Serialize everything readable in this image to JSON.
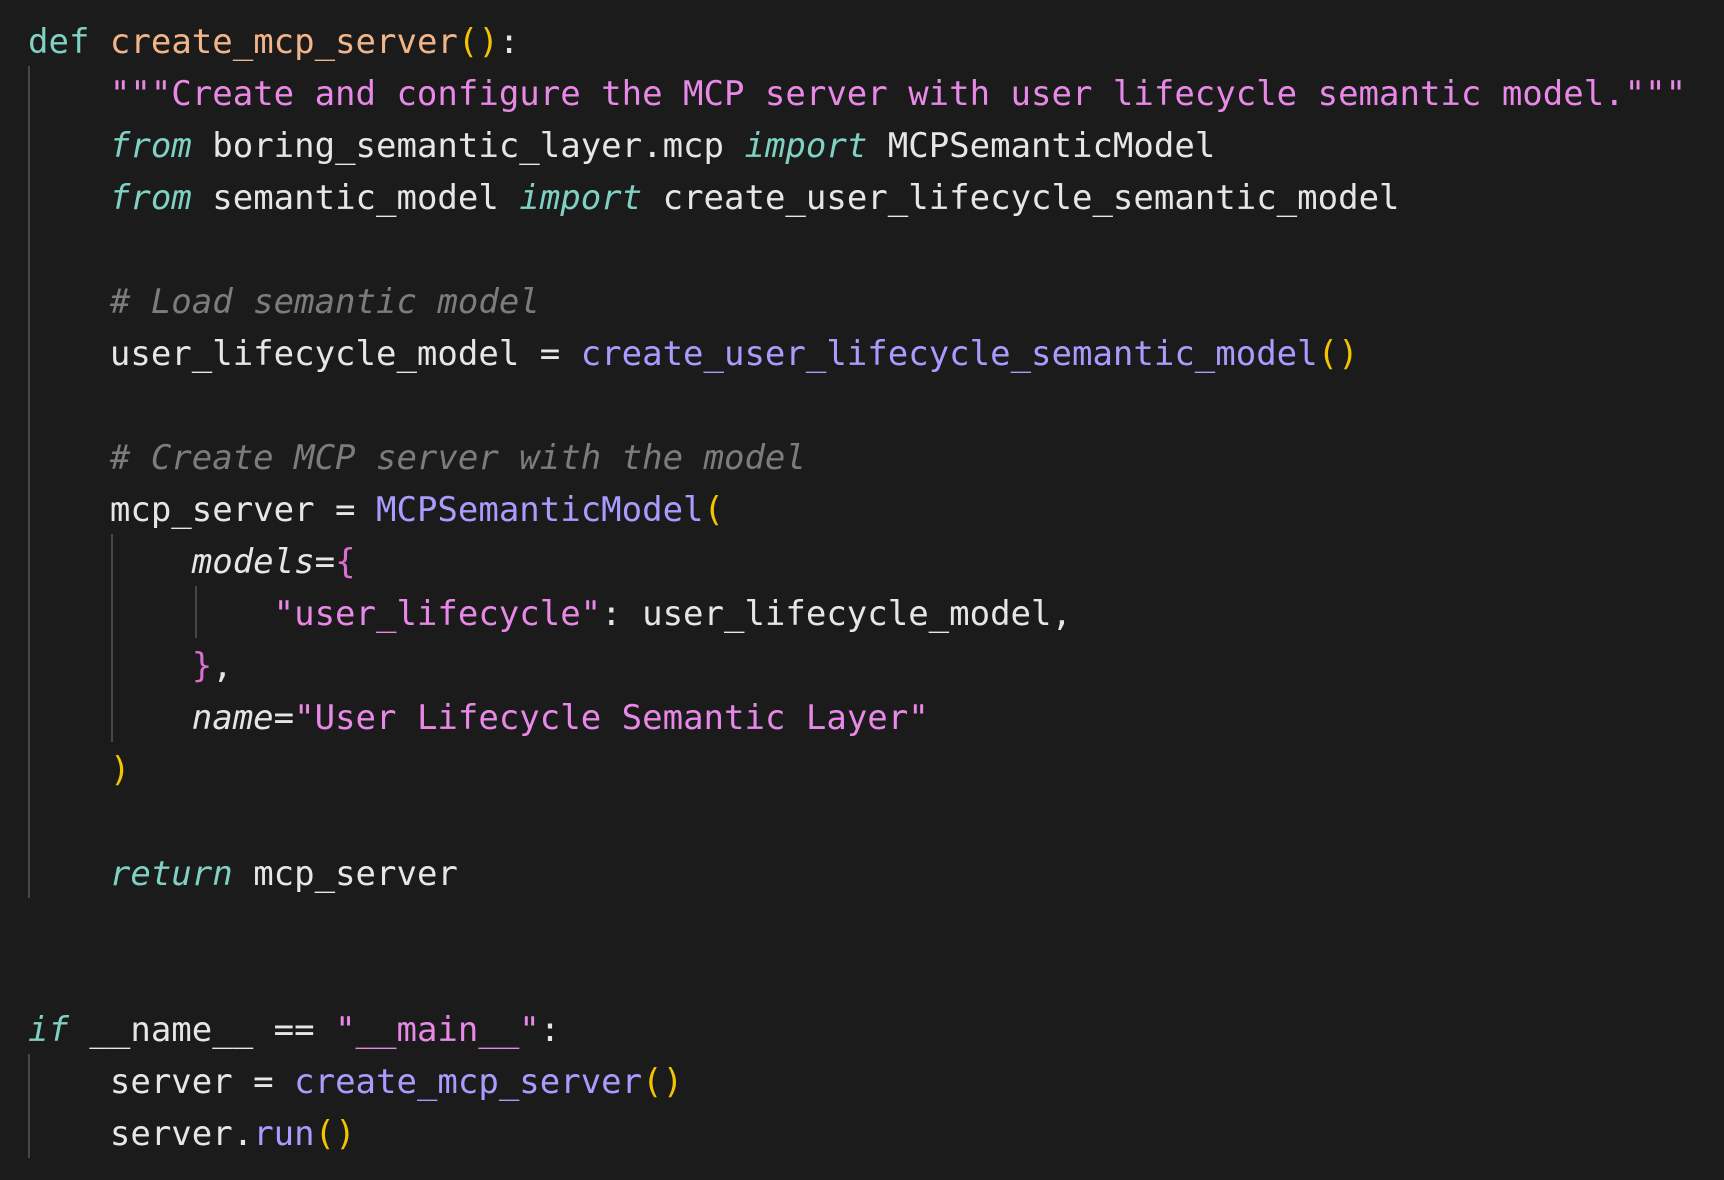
{
  "code": {
    "l1": {
      "kw": "def",
      "sp": " ",
      "fn": "create_mcp_server",
      "p": "()",
      "c": ":"
    },
    "l2": {
      "indent": "    ",
      "doc": "\"\"\"Create and configure the MCP server with user lifecycle semantic model.\"\"\""
    },
    "l3": {
      "indent": "    ",
      "kw_from": "from",
      "mod": " boring_semantic_layer.mcp ",
      "kw_import": "import",
      "name": " MCPSemanticModel"
    },
    "l4": {
      "indent": "    ",
      "kw_from": "from",
      "mod": " semantic_model ",
      "kw_import": "import",
      "name": " create_user_lifecycle_semantic_model"
    },
    "l6": {
      "indent": "    ",
      "comment": "# Load semantic model"
    },
    "l7": {
      "indent": "    ",
      "lhs": "user_lifecycle_model = ",
      "call": "create_user_lifecycle_semantic_model",
      "p": "()"
    },
    "l9": {
      "indent": "    ",
      "comment": "# Create MCP server with the model"
    },
    "l10": {
      "indent": "    ",
      "lhs": "mcp_server = ",
      "cls": "MCPSemanticModel",
      "p": "("
    },
    "l11": {
      "indent": "        ",
      "kwarg": "models",
      "eq": "=",
      "brace": "{"
    },
    "l12": {
      "indent": "            ",
      "key": "\"user_lifecycle\"",
      "rest": ": user_lifecycle_model,"
    },
    "l13": {
      "indent": "        ",
      "brace": "}",
      "rest": ","
    },
    "l14": {
      "indent": "        ",
      "kwarg": "name",
      "eq": "=",
      "str": "\"User Lifecycle Semantic Layer\""
    },
    "l15": {
      "indent": "    ",
      "p": ")"
    },
    "l17": {
      "indent": "    ",
      "kw": "return",
      "rest": " mcp_server"
    },
    "l20": {
      "kw": "if",
      "rest1": " __name__ == ",
      "str": "\"__main__\"",
      "rest2": ":"
    },
    "l21": {
      "indent": "    ",
      "lhs": "server = ",
      "call": "create_mcp_server",
      "p": "()"
    },
    "l22": {
      "indent": "    ",
      "obj": "server.",
      "call": "run",
      "p": "()"
    }
  },
  "colors": {
    "background": "#1b1b1b",
    "keyword": "#7fd1c3",
    "function_name": "#f2b58a",
    "paren": "#f5c400",
    "brace": "#d96fd2",
    "string": "#e889e8",
    "comment": "#7c7c7c",
    "call": "#a99cff",
    "text": "#e6e6e6"
  }
}
